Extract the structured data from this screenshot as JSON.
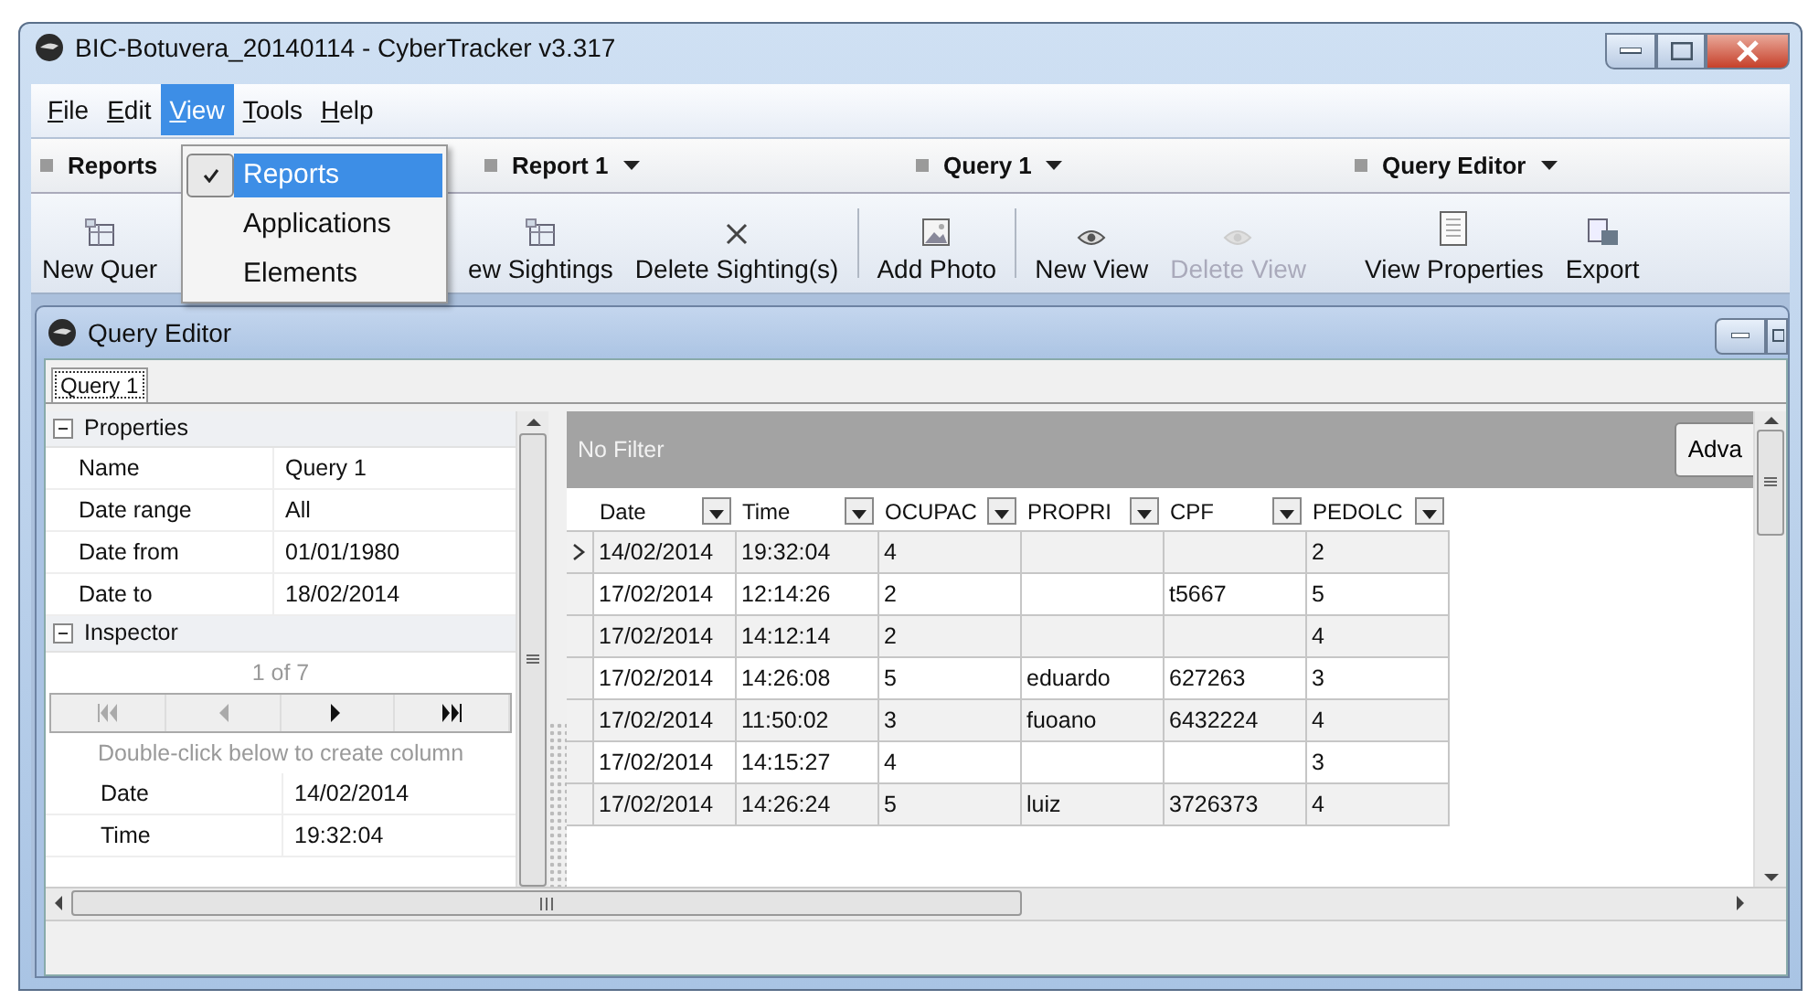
{
  "window": {
    "title": "BIC-Botuvera_20140114 - CyberTracker v3.317"
  },
  "menu": [
    {
      "label": "File",
      "selected": false
    },
    {
      "label": "Edit",
      "selected": false
    },
    {
      "label": "View",
      "selected": true
    },
    {
      "label": "Tools",
      "selected": false
    },
    {
      "label": "Help",
      "selected": false
    }
  ],
  "view_menu": [
    {
      "label": "Reports",
      "checked": true,
      "selected": true
    },
    {
      "label": "Applications",
      "checked": false,
      "selected": false
    },
    {
      "label": "Elements",
      "checked": false,
      "selected": false
    }
  ],
  "bands": [
    {
      "label": "Reports",
      "dropdown": false
    },
    {
      "label": "Report 1",
      "dropdown": true
    },
    {
      "label": "Query 1",
      "dropdown": true
    },
    {
      "label": "Query Editor",
      "dropdown": true
    }
  ],
  "toolbar": [
    {
      "label": "New Quer",
      "kind": "new",
      "disabled": false
    },
    {
      "label": "ew Sightings",
      "kind": "new",
      "disabled": false
    },
    {
      "label": "Delete Sighting(s)",
      "kind": "delete",
      "disabled": false
    },
    {
      "label": "Add Photo",
      "kind": "photo",
      "disabled": false
    },
    {
      "label": "New View",
      "kind": "view",
      "disabled": false
    },
    {
      "label": "Delete View",
      "kind": "view",
      "disabled": true
    },
    {
      "label": "View Properties",
      "kind": "properties",
      "disabled": false
    },
    {
      "label": "Export",
      "kind": "export",
      "disabled": false
    }
  ],
  "child_window": {
    "title": "Query Editor"
  },
  "tabs": [
    {
      "label": "Query 1",
      "selected": true
    }
  ],
  "properties": {
    "title": "Properties",
    "expanded": true,
    "rows": [
      {
        "name": "Name",
        "value": "Query 1"
      },
      {
        "name": "Date range",
        "value": "All"
      },
      {
        "name": "Date from",
        "value": "01/01/1980"
      },
      {
        "name": "Date to",
        "value": "18/02/2014"
      }
    ]
  },
  "inspector": {
    "title": "Inspector",
    "expanded": true,
    "position": "1 of 7",
    "nav": [
      {
        "kind": "first",
        "disabled": true
      },
      {
        "kind": "prev",
        "disabled": true
      },
      {
        "kind": "next",
        "disabled": false
      },
      {
        "kind": "last",
        "disabled": false
      }
    ],
    "hint": "Double-click below to create column",
    "rows": [
      {
        "name": "Date",
        "value": "14/02/2014"
      },
      {
        "name": "Time",
        "value": "19:32:04"
      }
    ]
  },
  "filter": {
    "label": "No Filter",
    "button": "Adva"
  },
  "grid": {
    "columns": [
      "Date",
      "Time",
      "OCUPAC",
      "PROPRI",
      "CPF",
      "PEDOLC"
    ],
    "rows": [
      {
        "selected": true,
        "cells": [
          "14/02/2014",
          "19:32:04",
          "4",
          "",
          "",
          "2"
        ]
      },
      {
        "selected": false,
        "cells": [
          "17/02/2014",
          "12:14:26",
          "2",
          "",
          "t5667",
          "5"
        ]
      },
      {
        "selected": false,
        "cells": [
          "17/02/2014",
          "14:12:14",
          "2",
          "",
          "",
          "4"
        ]
      },
      {
        "selected": false,
        "cells": [
          "17/02/2014",
          "14:26:08",
          "5",
          "eduardo",
          "627263",
          "3"
        ]
      },
      {
        "selected": false,
        "cells": [
          "17/02/2014",
          "11:50:02",
          "3",
          "fuoano",
          "6432224",
          "4"
        ]
      },
      {
        "selected": false,
        "cells": [
          "17/02/2014",
          "14:15:27",
          "4",
          "",
          "",
          "3"
        ]
      },
      {
        "selected": false,
        "cells": [
          "17/02/2014",
          "14:26:24",
          "5",
          "luiz",
          "3726373",
          "4"
        ]
      }
    ]
  }
}
